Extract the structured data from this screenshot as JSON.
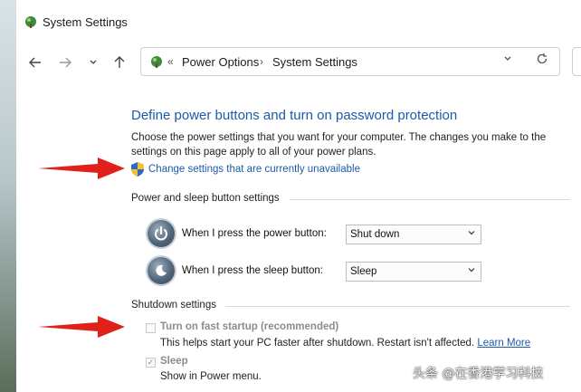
{
  "window": {
    "title": "System Settings"
  },
  "nav": {
    "back_icon": "back-arrow-icon",
    "forward_icon": "forward-arrow-icon",
    "recent_icon": "chevron-down-icon",
    "up_icon": "up-arrow-icon"
  },
  "address": {
    "separator": "«",
    "crumbs": [
      "Power Options",
      "System Settings"
    ],
    "chevron": "›",
    "refresh_icon": "refresh-icon"
  },
  "content": {
    "heading": "Define power buttons and turn on password protection",
    "description": "Choose the power settings that you want for your computer. The changes you make to the settings on this page apply to all of your power plans.",
    "change_link": "Change settings that are currently unavailable",
    "power_group": {
      "label": "Power and sleep button settings",
      "rows": [
        {
          "label": "When I press the power button:",
          "value": "Shut down"
        },
        {
          "label": "When I press the sleep button:",
          "value": "Sleep"
        }
      ]
    },
    "shutdown_group": {
      "label": "Shutdown settings",
      "fast_startup": {
        "label": "Turn on fast startup (recommended)",
        "checked": false,
        "description": "This helps start your PC faster after shutdown. Restart isn't affected.",
        "learn_more": "Learn More"
      },
      "sleep": {
        "label": "Sleep",
        "checked": true,
        "description": "Show in Power menu."
      }
    }
  },
  "annotations": {
    "arrow_color": "#e0201a"
  },
  "watermark": "头条 @在香港学习科技",
  "colors": {
    "link": "#1e5aa8",
    "accent": "#1e5aa8"
  }
}
